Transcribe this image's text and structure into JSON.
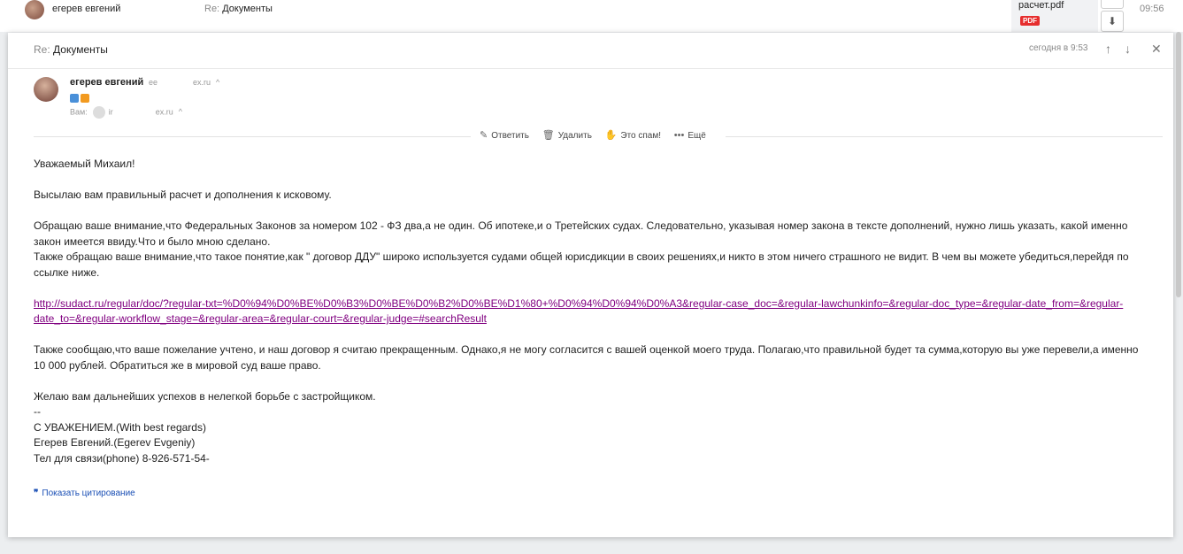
{
  "list_row": {
    "sender": "егерев евгений",
    "subject_prefix": "Re:",
    "subject": "Документы",
    "attachment_name": "расчет.pdf",
    "attachment_badge": "PDF",
    "download_icon": "⬇",
    "time": "09:56"
  },
  "header": {
    "subject_prefix": "Re:",
    "subject": "Документы",
    "date": "сегодня в 9:53",
    "prev_icon": "↑",
    "next_icon": "↓",
    "close_icon": "✕"
  },
  "from": {
    "name": "егерев евгений",
    "email_start": "ee",
    "email_end": "ex.ru",
    "to_label": "Вам:",
    "to_start": "ir",
    "to_end": "ex.ru",
    "caret": "^"
  },
  "actions": [
    {
      "label": "Ответить",
      "icon": "✎"
    },
    {
      "label": "Удалить",
      "icon": "🗑"
    },
    {
      "label": "Это спам!",
      "icon": "✋"
    },
    {
      "label": "Ещё",
      "icon": "•••"
    }
  ],
  "body": {
    "greeting": "Уважаемый Михаил!",
    "p1": "Высылаю вам правильный расчет и дополнения к исковому.",
    "p2": "Обращаю ваше внимание,что Федеральных Законов за номером 102 - ФЗ два,а не один. Об ипотеке,и о Третейских судах. Следовательно, указывая номер закона в тексте дополнений, нужно лишь указать, какой именно закон имеется ввиду.Что и было мною сделано.",
    "p3": "Также обращаю ваше внимание,что такое понятие,как \" договор ДДУ\" широко используется судами общей юрисдикции в своих решениях,и никто в этом ничего страшного не видит. В чем вы можете убедиться,перейдя по ссылке ниже.",
    "link": "http://sudact.ru/regular/doc/?regular-txt=%D0%94%D0%BE%D0%B3%D0%BE%D0%B2%D0%BE%D1%80+%D0%94%D0%94%D0%A3&regular-case_doc=&regular-lawchunkinfo=&regular-doc_type=&regular-date_from=&regular-date_to=&regular-workflow_stage=&regular-area=&regular-court=&regular-judge=#searchResult",
    "p4": "Также сообщаю,что ваше пожелание учтено, и наш договор я считаю прекращенным. Однако,я не могу согласится с вашей оценкой моего труда. Полагаю,что правильной будет та сумма,которую вы уже перевели,а именно 10 000 рублей. Обратиться же в мировой суд ваше право.",
    "p5": "Желаю вам дальнейших успехов в нелегкой борьбе с застройщиком.",
    "sig_sep": "--",
    "sig1": "С УВАЖЕНИЕМ.(With best regards)",
    "sig2": "Егерев Евгений.(Egerev Evgeniy)",
    "sig3": "Тел для связи(phone) 8-926-571-54-"
  },
  "quote_toggle": {
    "icon": "❞",
    "label": "Показать цитирование"
  }
}
